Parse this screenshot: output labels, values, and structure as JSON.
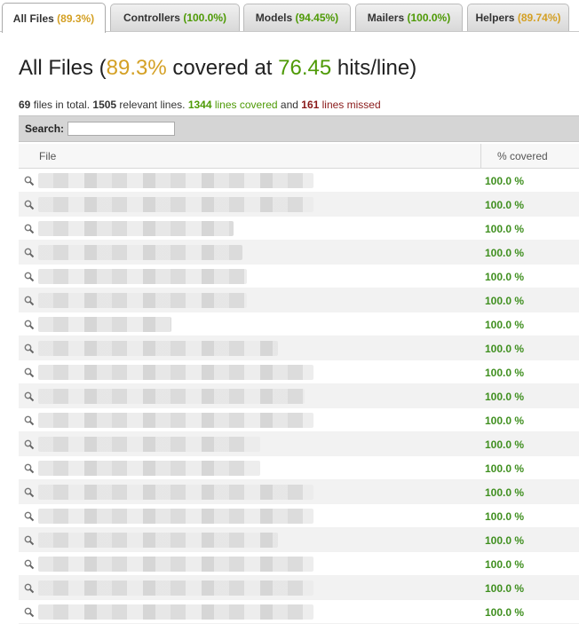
{
  "tabs": [
    {
      "label": "All Files",
      "pct": "(89.3%)",
      "pct_color": "#d4a024",
      "active": true
    },
    {
      "label": "Controllers",
      "pct": "(100.0%)",
      "pct_color": "#4e9a06",
      "active": false
    },
    {
      "label": "Models",
      "pct": "(94.45%)",
      "pct_color": "#4e9a06",
      "active": false
    },
    {
      "label": "Mailers",
      "pct": "(100.0%)",
      "pct_color": "#4e9a06",
      "active": false
    },
    {
      "label": "Helpers",
      "pct": "(89.74%)",
      "pct_color": "#d4a024",
      "active": false
    }
  ],
  "header": {
    "title_prefix": "All Files (",
    "title_pct": "89.3%",
    "title_mid": " covered at ",
    "title_hits": "76.45",
    "title_suffix": " hits/line)"
  },
  "summary": {
    "files": "69",
    "files_text": " files in total. ",
    "relevant": "1505",
    "relevant_text": " relevant lines. ",
    "covered": "1344",
    "covered_text": " lines covered",
    "and_text": " and ",
    "missed": "161",
    "missed_text": " lines missed"
  },
  "search": {
    "label": "Search:",
    "value": "",
    "placeholder": ""
  },
  "table": {
    "headers": {
      "file": "File",
      "covered": "% covered"
    },
    "rows": [
      {
        "coverage": "100.0 %"
      },
      {
        "coverage": "100.0 %"
      },
      {
        "coverage": "100.0 %"
      },
      {
        "coverage": "100.0 %"
      },
      {
        "coverage": "100.0 %"
      },
      {
        "coverage": "100.0 %"
      },
      {
        "coverage": "100.0 %"
      },
      {
        "coverage": "100.0 %"
      },
      {
        "coverage": "100.0 %"
      },
      {
        "coverage": "100.0 %"
      },
      {
        "coverage": "100.0 %"
      },
      {
        "coverage": "100.0 %"
      },
      {
        "coverage": "100.0 %"
      },
      {
        "coverage": "100.0 %"
      },
      {
        "coverage": "100.0 %"
      },
      {
        "coverage": "100.0 %"
      },
      {
        "coverage": "100.0 %"
      },
      {
        "coverage": "100.0 %"
      },
      {
        "coverage": "100.0 %"
      }
    ]
  },
  "colors": {
    "yellow": "#d4a024",
    "green": "#4e9a06",
    "red": "#8a1a1a"
  },
  "icons": {
    "row_icon": "magnifier-icon"
  }
}
